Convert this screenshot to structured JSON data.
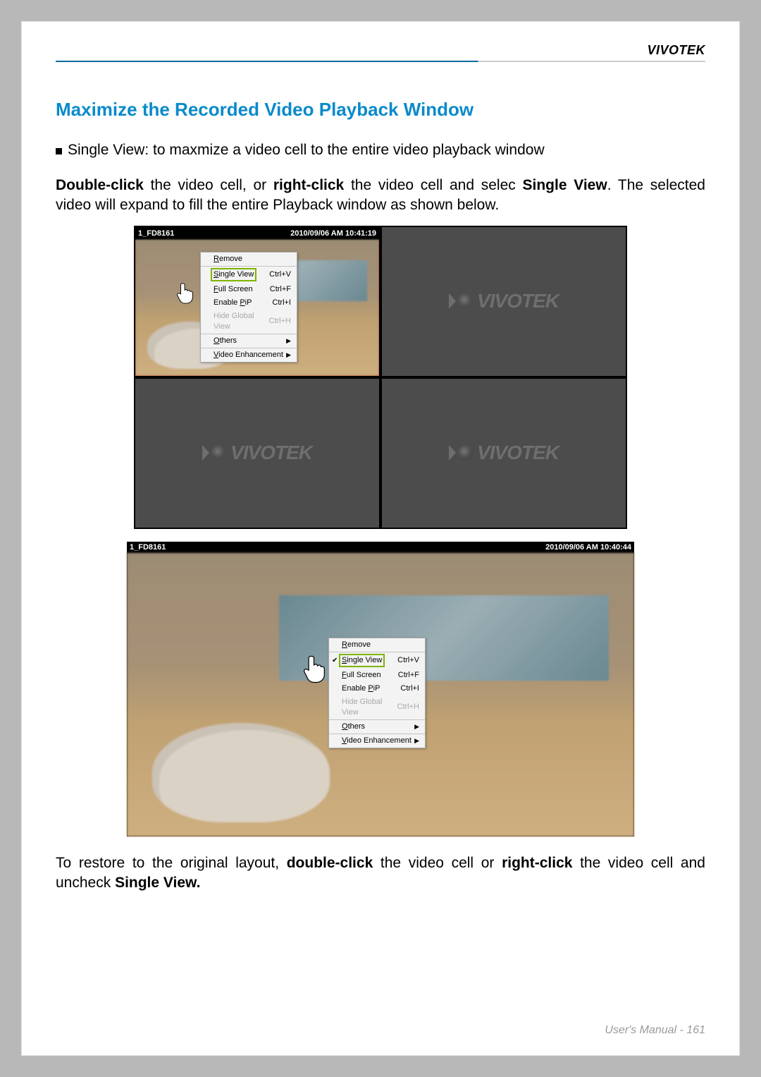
{
  "brand": "VIVOTEK",
  "section_title": "Maximize the Recorded Video Playback Window",
  "bullet_single_view": "Single View: to maxmize a video cell to the entire video playback window",
  "para1_a": "Double-click",
  "para1_b": " the video cell, or ",
  "para1_c": "right-click",
  "para1_d": " the video cell and selec ",
  "para1_e": "Single View",
  "para1_f": ". The selected video will expand to fill the entire Playback window as shown below.",
  "quad": {
    "cell_label": "1_FD8161",
    "timestamp": "2010/09/06 AM 10:41:19",
    "logo_text": "VIVOTEK",
    "menu": {
      "remove": "Remove",
      "single_view": "Single View",
      "single_view_sc": "Ctrl+V",
      "full_screen": "Full Screen",
      "full_screen_sc": "Ctrl+F",
      "enable_pip": "Enable PiP",
      "enable_pip_sc": "Ctrl+I",
      "hide_global": "Hide Global View",
      "hide_global_sc": "Ctrl+H",
      "others": "Others",
      "video_enh": "Video Enhancement"
    }
  },
  "single": {
    "cell_label": "1_FD8161",
    "timestamp": "2010/09/06 AM 10:40:44",
    "menu": {
      "remove": "Remove",
      "single_view": "Single View",
      "single_view_sc": "Ctrl+V",
      "full_screen": "Full Screen",
      "full_screen_sc": "Ctrl+F",
      "enable_pip": "Enable PiP",
      "enable_pip_sc": "Ctrl+I",
      "hide_global": "Hide Global View",
      "hide_global_sc": "Ctrl+H",
      "others": "Others",
      "video_enh": "Video Enhancement"
    }
  },
  "para2_a": "To restore to the original layout, ",
  "para2_b": "double-click",
  "para2_c": " the video cell or ",
  "para2_d": "right-click",
  "para2_e": " the video cell and uncheck ",
  "para2_f": "Single View.",
  "footer_label": "User's Manual - ",
  "footer_page": "161"
}
